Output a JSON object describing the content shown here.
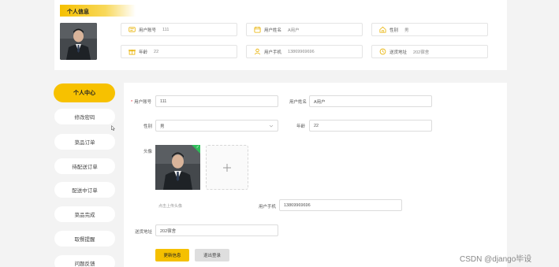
{
  "profile": {
    "section_title": "个人信息",
    "fields": [
      {
        "icon": "id-card-icon",
        "label": "用户账号",
        "value": "111"
      },
      {
        "icon": "calendar-icon",
        "label": "用户姓名",
        "value": "A用户"
      },
      {
        "icon": "home-icon",
        "label": "性别",
        "value": "男"
      },
      {
        "icon": "gift-icon",
        "label": "年龄",
        "value": "22"
      },
      {
        "icon": "user-icon",
        "label": "用户手机",
        "value": "13869969696"
      },
      {
        "icon": "clock-icon",
        "label": "送货地址",
        "value": "202宿舍"
      }
    ]
  },
  "sidebar": {
    "items": [
      {
        "label": "个人中心",
        "active": true
      },
      {
        "label": "修改密码"
      },
      {
        "label": "菜品订单"
      },
      {
        "label": "待配送订单"
      },
      {
        "label": "配送中订单"
      },
      {
        "label": "菜品完成"
      },
      {
        "label": "取餐提醒"
      },
      {
        "label": "问题反馈"
      }
    ]
  },
  "form": {
    "account_label": "用户账号",
    "account_value": "111",
    "name_label": "用户姓名",
    "name_value": "A用户",
    "gender_label": "性别",
    "gender_value": "男",
    "age_label": "年龄",
    "age_value": "22",
    "avatar_label": "头像",
    "upload_hint": "点击上传头像",
    "phone_label": "用户手机",
    "phone_value": "13869969696",
    "address_label": "送货地址",
    "address_value": "202宿舍",
    "update_button": "更新信息",
    "logout_button": "退出登录"
  },
  "watermark": "CSDN @django毕设",
  "colors": {
    "accent": "#f5c000",
    "background": "#f3f3f3",
    "check": "#2fbd5a"
  }
}
